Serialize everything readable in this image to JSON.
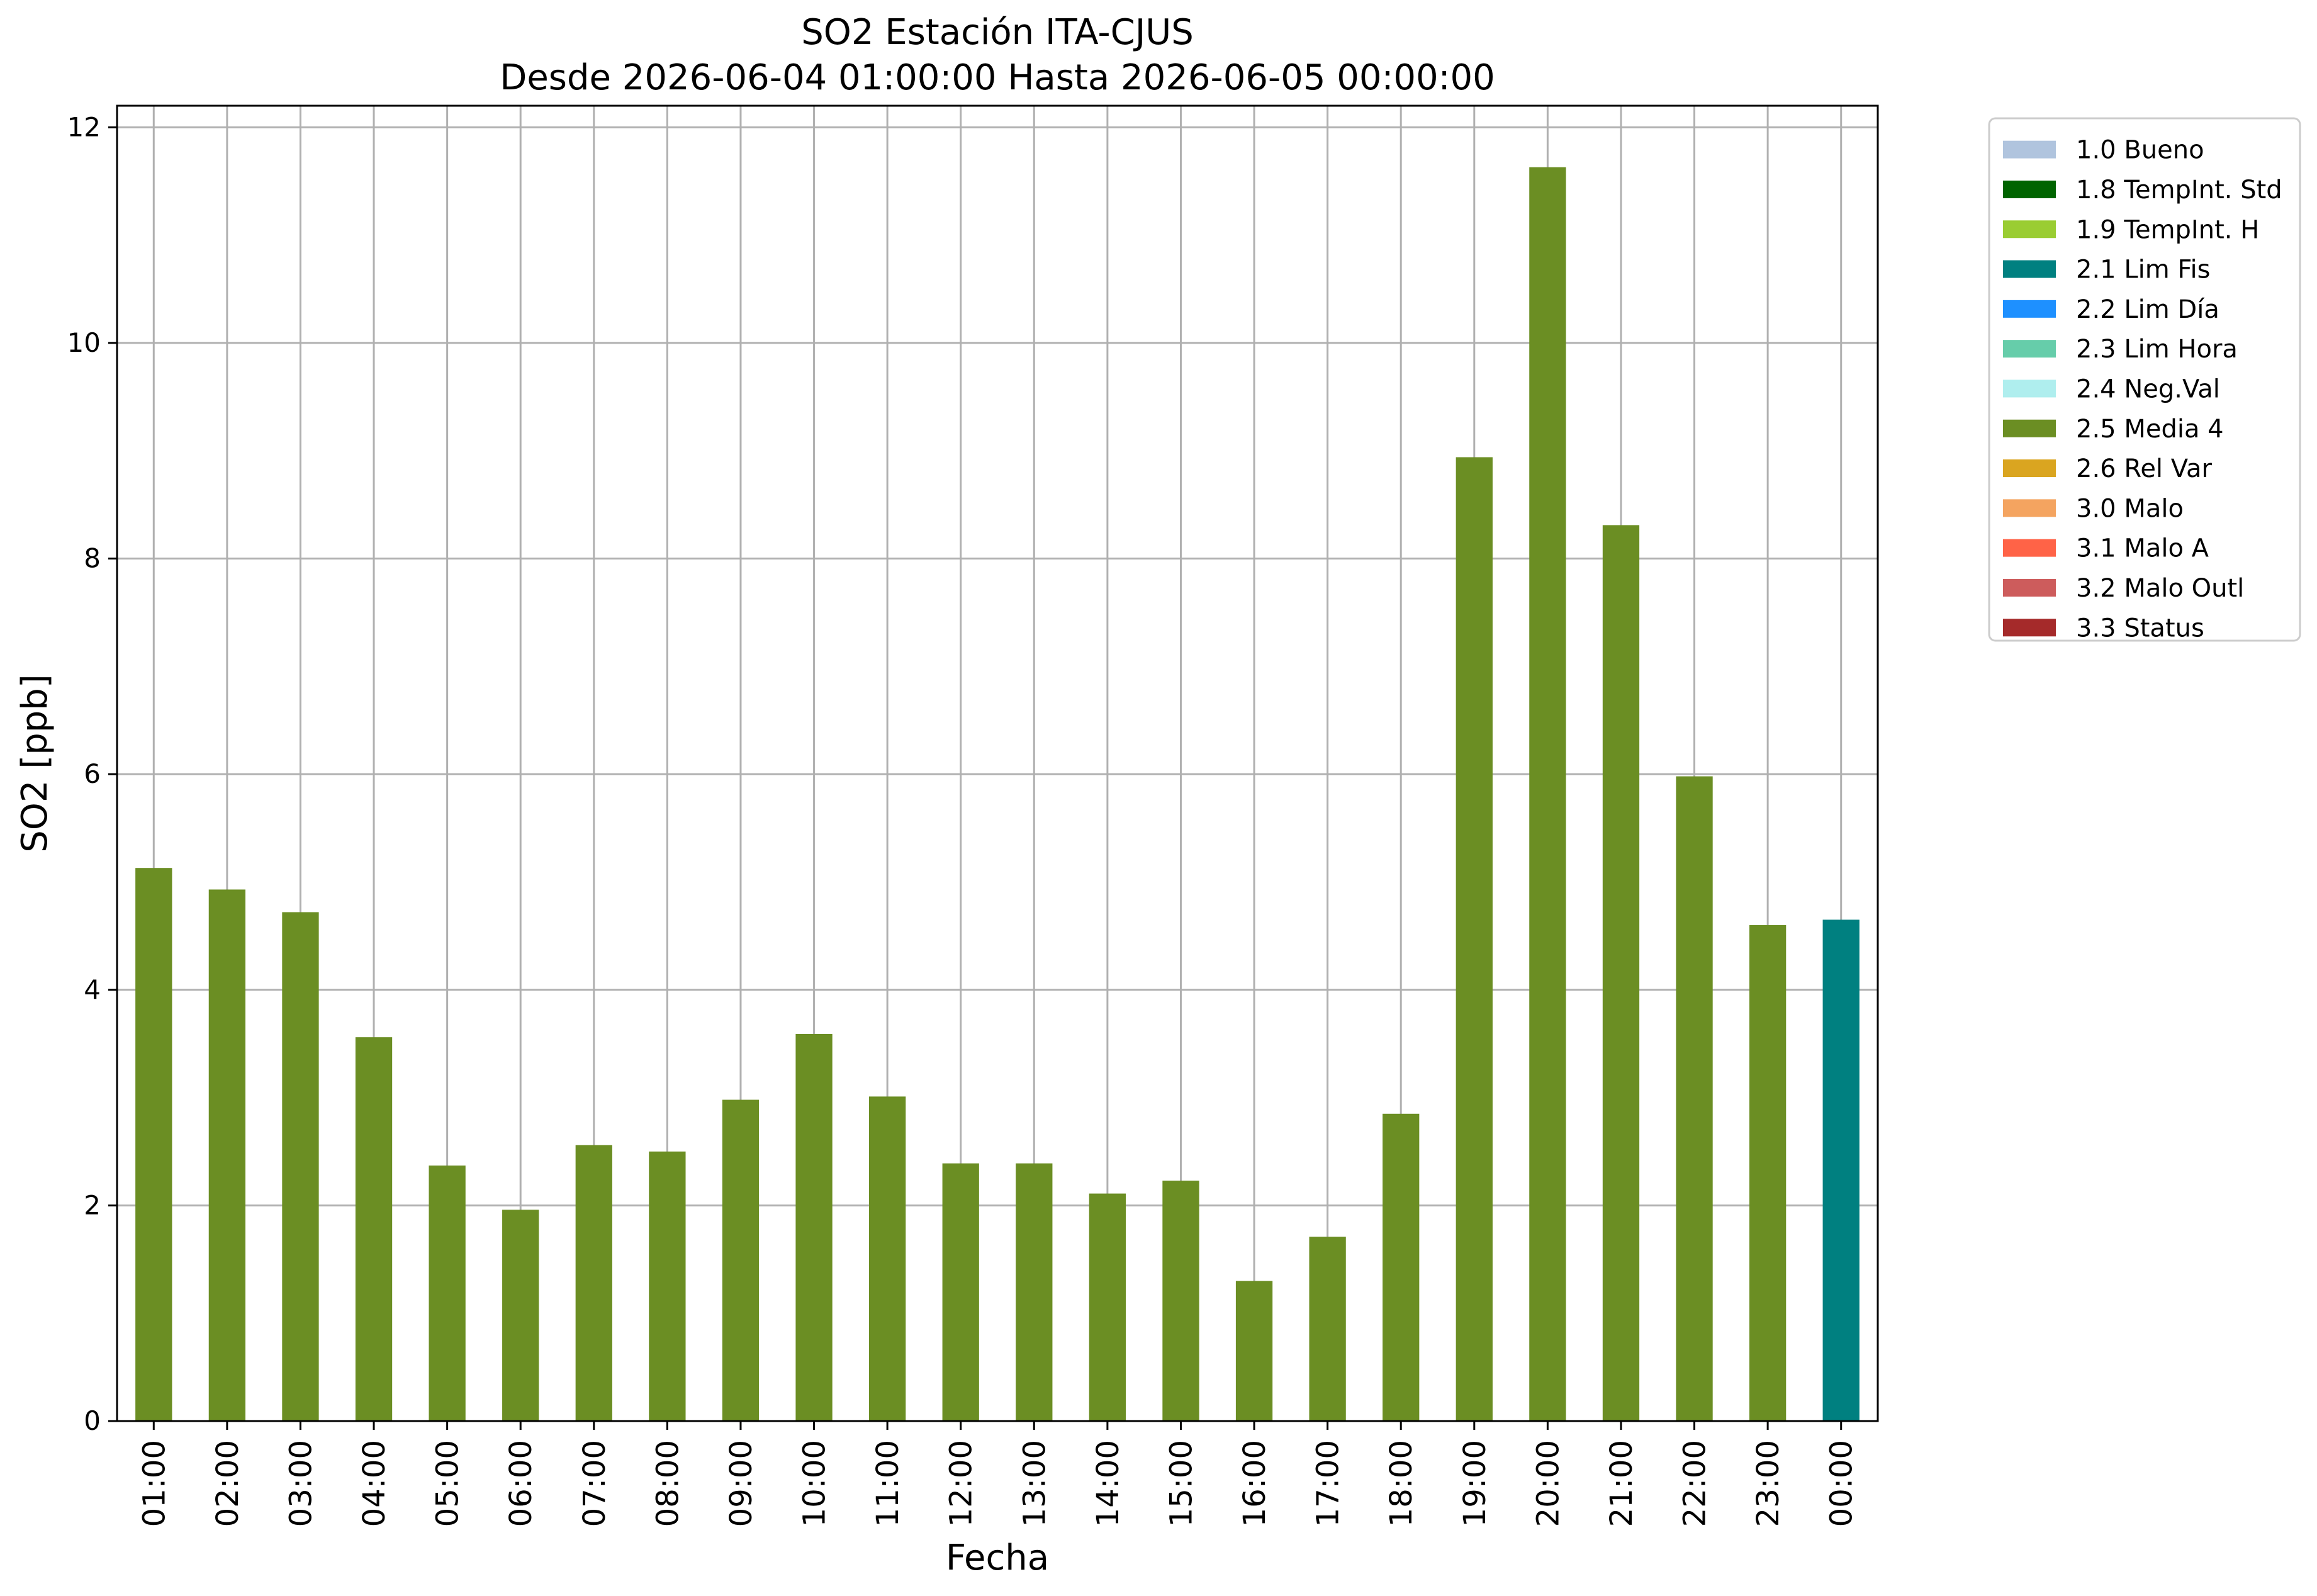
{
  "chart_data": {
    "type": "bar",
    "title": "SO2 Estación ITA-CJUS",
    "subtitle": "Desde 2026-06-04 01:00:00 Hasta 2026-06-05 00:00:00",
    "xlabel": "Fecha",
    "ylabel": "SO2 [ppb]",
    "ylim": [
      0,
      12.2
    ],
    "yticks": [
      0,
      2,
      4,
      6,
      8,
      10,
      12
    ],
    "ytick_labels": [
      "0",
      "2",
      "4",
      "6",
      "8",
      "10",
      "12"
    ],
    "grid": true,
    "legend_position": "outside-top-right",
    "categories": [
      "01:00",
      "02:00",
      "03:00",
      "04:00",
      "05:00",
      "06:00",
      "07:00",
      "08:00",
      "09:00",
      "10:00",
      "11:00",
      "12:00",
      "13:00",
      "14:00",
      "15:00",
      "16:00",
      "17:00",
      "18:00",
      "19:00",
      "20:00",
      "21:00",
      "22:00",
      "23:00",
      "00:00"
    ],
    "values": [
      5.13,
      4.93,
      4.72,
      3.56,
      2.37,
      1.96,
      2.56,
      2.5,
      2.98,
      3.59,
      3.01,
      2.39,
      2.39,
      2.11,
      2.23,
      1.3,
      1.71,
      2.85,
      8.94,
      11.63,
      8.31,
      5.98,
      4.6,
      4.65
    ],
    "value_flags": [
      "2.5 Media 4",
      "2.5 Media 4",
      "2.5 Media 4",
      "2.5 Media 4",
      "2.5 Media 4",
      "2.5 Media 4",
      "2.5 Media 4",
      "2.5 Media 4",
      "2.5 Media 4",
      "2.5 Media 4",
      "2.5 Media 4",
      "2.5 Media 4",
      "2.5 Media 4",
      "2.5 Media 4",
      "2.5 Media 4",
      "2.5 Media 4",
      "2.5 Media 4",
      "2.5 Media 4",
      "2.5 Media 4",
      "2.5 Media 4",
      "2.5 Media 4",
      "2.5 Media 4",
      "2.5 Media 4",
      "2.1 Lim Fis"
    ],
    "legend": [
      {
        "label": "1.0 Bueno",
        "color": "#b0c4de"
      },
      {
        "label": "1.8 TempInt. Std",
        "color": "#006400"
      },
      {
        "label": "1.9 TempInt. H",
        "color": "#9acd32"
      },
      {
        "label": "2.1 Lim Fis",
        "color": "#008080"
      },
      {
        "label": "2.2 Lim Día",
        "color": "#1e90ff"
      },
      {
        "label": "2.3 Lim Hora",
        "color": "#66cdaa"
      },
      {
        "label": "2.4 Neg.Val",
        "color": "#afeeee"
      },
      {
        "label": "2.5 Media 4",
        "color": "#6b8e23"
      },
      {
        "label": "2.6 Rel Var",
        "color": "#daa520"
      },
      {
        "label": "3.0 Malo",
        "color": "#f4a460"
      },
      {
        "label": "3.1 Malo A",
        "color": "#ff6347"
      },
      {
        "label": "3.2 Malo Outl",
        "color": "#cd5c5c"
      },
      {
        "label": "3.3 Status",
        "color": "#a52a2a"
      }
    ]
  }
}
